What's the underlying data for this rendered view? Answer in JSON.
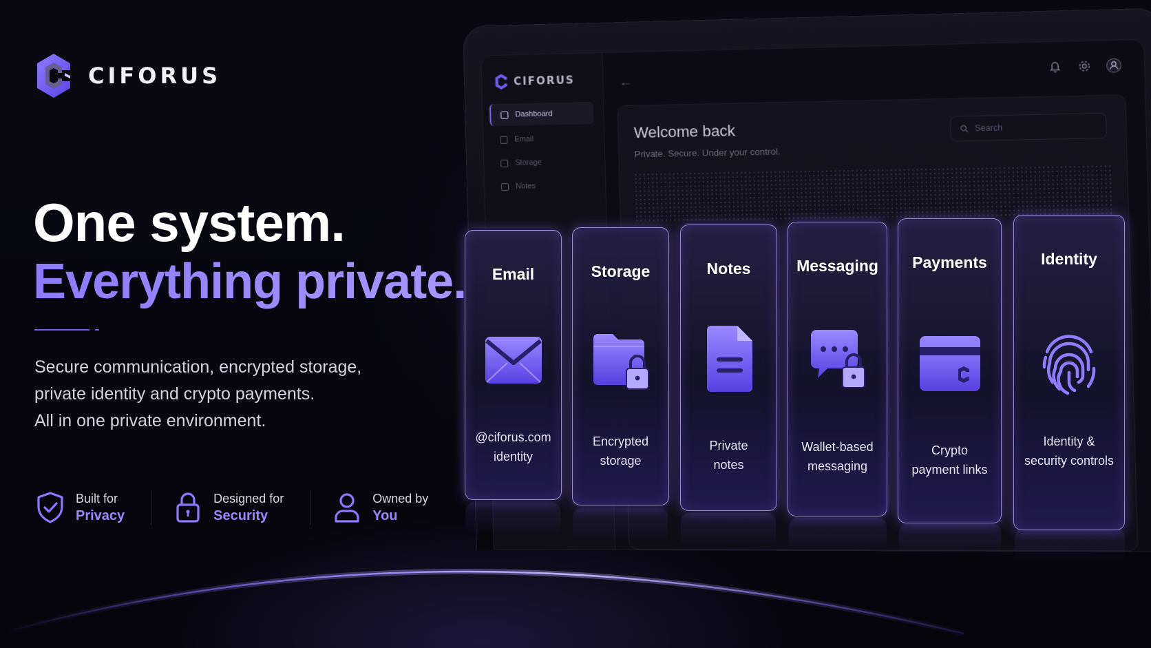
{
  "brand": {
    "name": "CIFORUS"
  },
  "hero": {
    "line1": "One system.",
    "line2": "Everything private.",
    "description": [
      "Secure communication, encrypted storage,",
      "private identity and crypto payments.",
      "All in one private environment."
    ]
  },
  "badges": [
    {
      "top": "Built for",
      "bottom": "Privacy",
      "icon": "shield-check-icon"
    },
    {
      "top": "Designed for",
      "bottom": "Security",
      "icon": "lock-icon"
    },
    {
      "top": "Owned by",
      "bottom": "You",
      "icon": "user-icon"
    }
  ],
  "dashboard": {
    "brand": "CIFORUS",
    "nav": [
      {
        "label": "Dashboard",
        "active": true
      },
      {
        "label": "Email",
        "active": false
      },
      {
        "label": "Storage",
        "active": false
      },
      {
        "label": "Notes",
        "active": false
      }
    ],
    "back_icon": "arrow-left-icon",
    "welcome_title": "Welcome back",
    "welcome_subtitle": "Private. Secure. Under your control.",
    "search_placeholder": "Search",
    "top_icons": [
      "bell-icon",
      "gear-icon",
      "avatar-icon"
    ]
  },
  "cards": [
    {
      "title": "Email",
      "desc": [
        "@ciforus.com",
        "identity"
      ],
      "icon": "envelope-icon"
    },
    {
      "title": "Storage",
      "desc": [
        "Encrypted",
        "storage"
      ],
      "icon": "folder-lock-icon"
    },
    {
      "title": "Notes",
      "desc": [
        "Private",
        "notes"
      ],
      "icon": "document-icon"
    },
    {
      "title": "Messaging",
      "desc": [
        "Wallet-based",
        "messaging"
      ],
      "icon": "chat-lock-icon"
    },
    {
      "title": "Payments",
      "desc": [
        "Crypto",
        "payment links"
      ],
      "icon": "card-icon"
    },
    {
      "title": "Identity",
      "desc": [
        "Identity &",
        "security controls"
      ],
      "icon": "fingerprint-icon"
    }
  ],
  "colors": {
    "accent": "#8d7bff",
    "accent_dark": "#5d45e8",
    "background": "#07060c"
  }
}
